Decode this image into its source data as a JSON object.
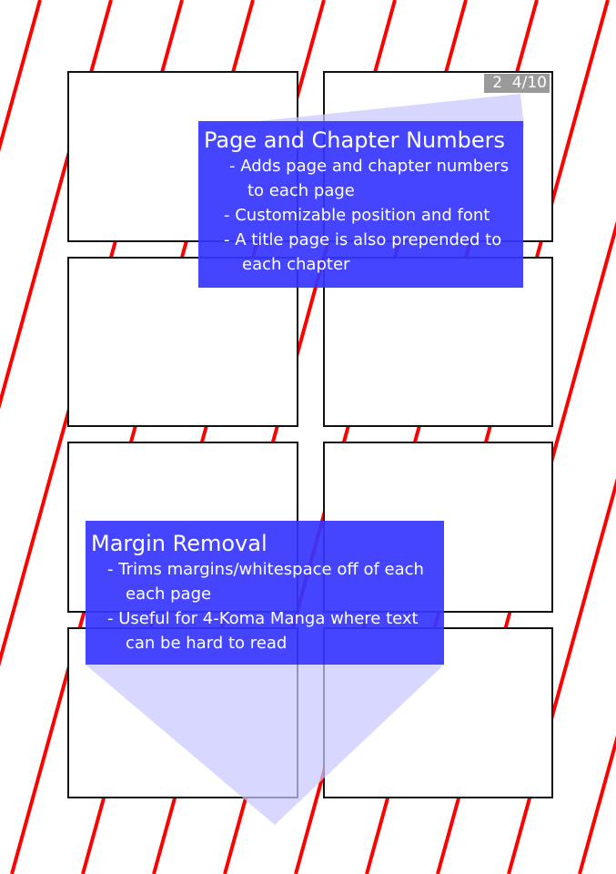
{
  "page_indicator": {
    "text": "2  4/10"
  },
  "features": [
    {
      "title": "Page and Chapter Numbers",
      "bullets": [
        {
          "line1": "- Adds page and chapter numbers",
          "line2": "to each page"
        },
        {
          "line1": "- Customizable position and font",
          "line2": ""
        },
        {
          "line1": "- A title page is also prepended to",
          "line2": "each chapter"
        }
      ]
    },
    {
      "title": "Margin Removal",
      "bullets": [
        {
          "line1": "- Trims margins/whitespace off of each",
          "line2": "each page"
        },
        {
          "line1": "- Useful for 4-Koma Manga where text",
          "line2": "can be hard to read"
        }
      ]
    }
  ],
  "colors": {
    "stripe": "#ff0000",
    "callout_box": "#3535ff",
    "callout_pointer": "#d8d8ff",
    "page_indicator_bg": "#9a9a9a",
    "panel_border": "#111111"
  }
}
